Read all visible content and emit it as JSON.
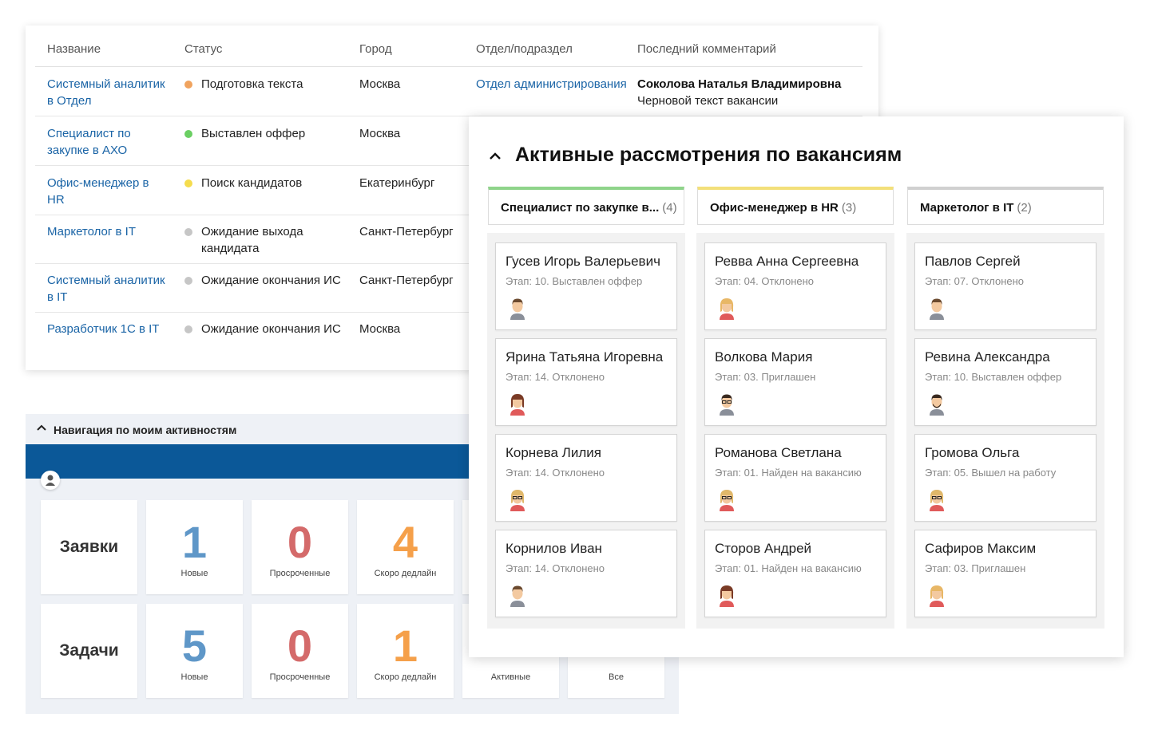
{
  "vacancies_table": {
    "headers": [
      "Название",
      "Статус",
      "Город",
      "Отдел/подраздел",
      "Последний комментарий"
    ],
    "rows": [
      {
        "name": "Системный аналитик в Отдел",
        "status": "Подготовка текста",
        "status_color": "#f0a35e",
        "city": "Москва",
        "dept": "Отдел администрирования",
        "comment_author": "Соколова Наталья Владимировна",
        "comment_text": "Черновой текст вакансии"
      },
      {
        "name": "Специалист по закупке в АХО",
        "status": "Выставлен оффер",
        "status_color": "#6bcf63",
        "city": "Москва"
      },
      {
        "name": "Офис-менеджер в HR",
        "status": "Поиск кандидатов",
        "status_color": "#f5dc4d",
        "city": "Екатеринбург"
      },
      {
        "name": "Маркетолог в IT",
        "status": "Ожидание выхода кандидата",
        "status_color": "#c6c6c6",
        "city": "Санкт-Петербург"
      },
      {
        "name": "Системный аналитик в IT",
        "status": "Ожидание окончания ИС",
        "status_color": "#c6c6c6",
        "city": "Санкт-Петербург"
      },
      {
        "name": "Разработчик 1С в IT",
        "status": "Ожидание окончания ИС",
        "status_color": "#c6c6c6",
        "city": "Москва"
      }
    ]
  },
  "activity_nav": {
    "title": "Навигация по моим активностям",
    "rows": [
      {
        "label": "Заявки",
        "tiles": [
          {
            "value": "1",
            "caption": "Новые",
            "color": "#5f97c8"
          },
          {
            "value": "0",
            "caption": "Просроченные",
            "color": "#d46a6a"
          },
          {
            "value": "4",
            "caption": "Скоро дедлайн",
            "color": "#f5a04a"
          }
        ]
      },
      {
        "label": "Задачи",
        "tiles": [
          {
            "value": "5",
            "caption": "Новые",
            "color": "#5f97c8"
          },
          {
            "value": "0",
            "caption": "Просроченные",
            "color": "#d46a6a"
          },
          {
            "value": "1",
            "caption": "Скоро дедлайн",
            "color": "#f5a04a"
          },
          {
            "caption": "Активные"
          },
          {
            "caption": "Все"
          }
        ]
      }
    ]
  },
  "active_reviews": {
    "title": "Активные рассмотрения по вакансиям",
    "columns": [
      {
        "name": "Специалист по закупке в...",
        "count": "(4)",
        "accent": "#8fd48a",
        "cards": [
          {
            "name": "Гусев Игорь Валерьевич",
            "stage": "Этап: 10. Выставлен оффер",
            "avatar": "man-short-hair-icon"
          },
          {
            "name": "Ярина Татьяна Игоревна",
            "stage": "Этап: 14. Отклонено",
            "avatar": "woman-brown-hair-icon"
          },
          {
            "name": "Корнева Лилия",
            "stage": "Этап: 14. Отклонено",
            "avatar": "woman-glasses-icon"
          },
          {
            "name": "Корнилов Иван",
            "stage": "Этап: 14. Отклонено",
            "avatar": "man-short-hair-icon"
          }
        ]
      },
      {
        "name": "Офис-менеджер в HR",
        "count": "(3)",
        "accent": "#f3e07a",
        "cards": [
          {
            "name": "Ревва Анна Сергеевна",
            "stage": "Этап: 04. Отклонено",
            "avatar": "woman-blonde-icon"
          },
          {
            "name": "Волкова Мария",
            "stage": "Этап: 03. Приглашен",
            "avatar": "man-glasses-icon"
          },
          {
            "name": "Романова Светлана",
            "stage": "Этап: 01. Найден на вакансию",
            "avatar": "woman-glasses-icon"
          },
          {
            "name": "Сторов Андрей",
            "stage": "Этап: 01. Найден на вакансию",
            "avatar": "woman-brown-hair-icon"
          }
        ]
      },
      {
        "name": "Маркетолог в IT",
        "count": "(2)",
        "accent": "#d0d0d0",
        "cards": [
          {
            "name": "Павлов Сергей",
            "stage": "Этап: 07. Отклонено",
            "avatar": "man-short-hair-icon"
          },
          {
            "name": "Ревина Александра",
            "stage": "Этап: 10. Выставлен оффер",
            "avatar": "man-beard-icon"
          },
          {
            "name": "Громова Ольга",
            "stage": "Этап: 05. Вышел на работу",
            "avatar": "woman-glasses-icon"
          },
          {
            "name": "Сафиров Максим",
            "stage": "Этап: 03. Приглашен",
            "avatar": "woman-blonde-icon"
          }
        ]
      }
    ]
  }
}
